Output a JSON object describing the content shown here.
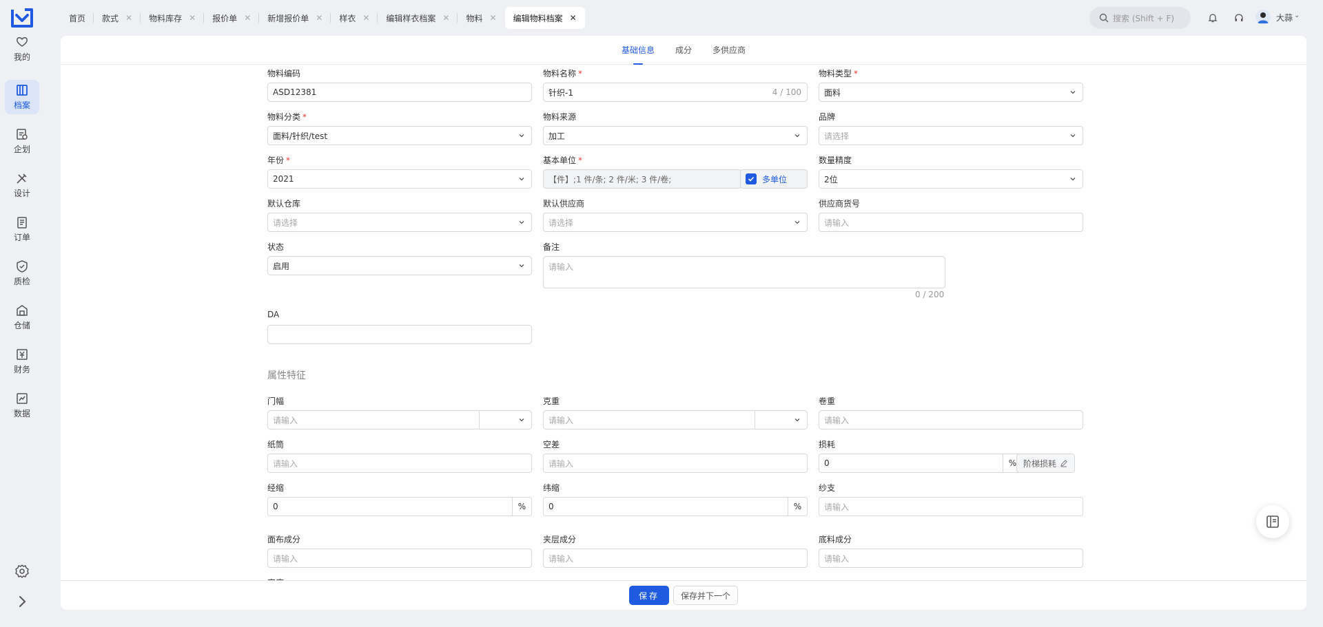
{
  "sidebar": {
    "items": [
      {
        "label": "我的",
        "icon": "heart-icon"
      },
      {
        "label": "档案",
        "icon": "archive-icon"
      },
      {
        "label": "企划",
        "icon": "plan-icon"
      },
      {
        "label": "设计",
        "icon": "design-icon"
      },
      {
        "label": "订单",
        "icon": "order-icon"
      },
      {
        "label": "质检",
        "icon": "shield-icon"
      },
      {
        "label": "仓储",
        "icon": "warehouse-icon"
      },
      {
        "label": "财务",
        "icon": "finance-icon"
      },
      {
        "label": "数据",
        "icon": "chart-icon"
      }
    ]
  },
  "tabs": [
    "首页",
    "款式",
    "物料库存",
    "报价单",
    "新增报价单",
    "样衣",
    "编辑样衣档案",
    "物料",
    "编辑物料档案"
  ],
  "header": {
    "search_placeholder": "搜索 (Shift + F)",
    "username": "大蒜"
  },
  "subtabs": [
    "基础信息",
    "成分",
    "多供应商"
  ],
  "form": {
    "material_code": {
      "label": "物料编码",
      "value": "ASD12381"
    },
    "material_name": {
      "label": "物料名称",
      "value": "针织-1",
      "count": "4 / 100"
    },
    "material_type": {
      "label": "物料类型",
      "value": "面料"
    },
    "material_category": {
      "label": "物料分类",
      "value": "面料/针织/test"
    },
    "material_source": {
      "label": "物料来源",
      "value": "加工"
    },
    "brand": {
      "label": "品牌",
      "placeholder": "请选择"
    },
    "year": {
      "label": "年份",
      "value": "2021"
    },
    "base_unit": {
      "label": "基本单位",
      "value": "【件】;1 件/条; 2 件/米; 3 件/卷;",
      "multi_label": "多单位"
    },
    "qty_precision": {
      "label": "数量精度",
      "value": "2位"
    },
    "default_warehouse": {
      "label": "默认仓库",
      "placeholder": "请选择"
    },
    "default_supplier": {
      "label": "默认供应商",
      "placeholder": "请选择"
    },
    "supplier_item_no": {
      "label": "供应商货号",
      "placeholder": "请输入"
    },
    "status": {
      "label": "状态",
      "value": "启用"
    },
    "remark": {
      "label": "备注",
      "placeholder": "请输入",
      "count": "0 / 200"
    },
    "da": {
      "label": "DA",
      "value": ""
    }
  },
  "attributes": {
    "title": "属性特征",
    "width": {
      "label": "门幅",
      "placeholder": "请输入"
    },
    "gram_weight": {
      "label": "克重",
      "placeholder": "请输入"
    },
    "roll_weight": {
      "label": "卷重",
      "placeholder": "请输入"
    },
    "paper_tube": {
      "label": "纸筒",
      "placeholder": "请输入"
    },
    "empty_diff": {
      "label": "空差",
      "placeholder": "请输入"
    },
    "loss": {
      "label": "损耗",
      "value": "0",
      "unit": "%",
      "step_label": "阶梯损耗"
    },
    "warp_shrink": {
      "label": "经缩",
      "value": "0",
      "unit": "%"
    },
    "weft_shrink": {
      "label": "纬缩",
      "value": "0",
      "unit": "%"
    },
    "yarn_count": {
      "label": "纱支",
      "placeholder": "请输入"
    },
    "face_comp": {
      "label": "面布成分",
      "placeholder": "请输入"
    },
    "mid_comp": {
      "label": "夹层成分",
      "placeholder": "请输入"
    },
    "base_comp": {
      "label": "底料成分",
      "placeholder": "请输入"
    },
    "density": {
      "label": "密度"
    }
  },
  "footer": {
    "save": "保存",
    "save_next": "保存并下一个"
  },
  "colors": {
    "primary": "#1f5ae0",
    "required": "#e53935"
  }
}
